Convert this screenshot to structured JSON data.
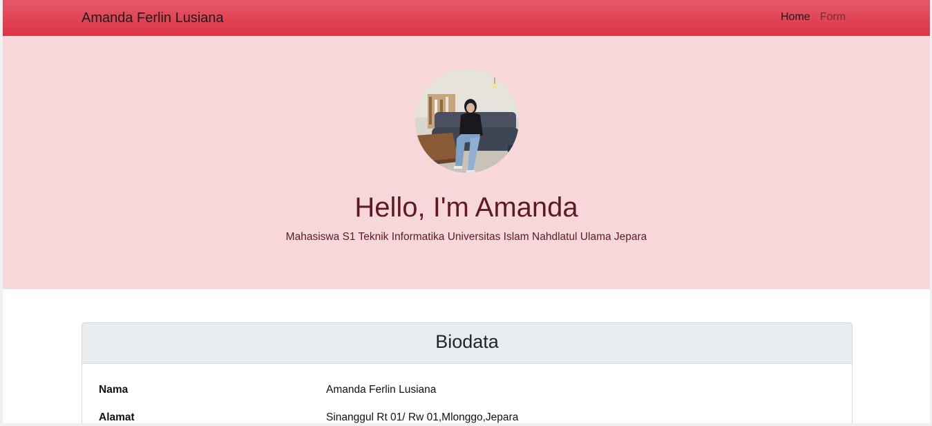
{
  "navbar": {
    "brand": "Amanda Ferlin Lusiana",
    "links": [
      {
        "label": "Home",
        "active": true
      },
      {
        "label": "Form",
        "active": false
      }
    ],
    "color": "#dc3545"
  },
  "hero": {
    "title": "Hello, I'm Amanda",
    "subtitle": "Mahasiswa S1 Teknik Informatika Universitas Islam Nahdlatul Ulama Jepara",
    "background": "#f8d7da",
    "avatar_icon": "profile-photo"
  },
  "biodata": {
    "title": "Biodata",
    "rows": [
      {
        "label": "Nama",
        "value": "Amanda Ferlin Lusiana"
      },
      {
        "label": "Alamat",
        "value": "Sinanggul Rt 01/ Rw 01,Mlonggo,Jepara"
      }
    ]
  }
}
